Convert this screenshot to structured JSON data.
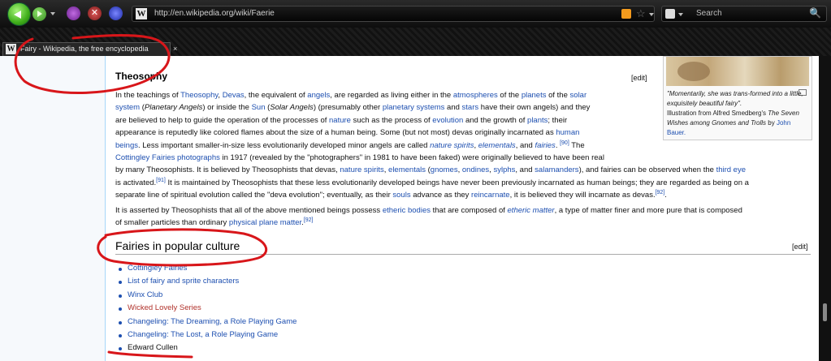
{
  "browser": {
    "url": "http://en.wikipedia.org/wiki/Faerie",
    "search_placeholder": "Search",
    "tab_title": "Fairy - Wikipedia, the free encyclopedia",
    "favicon_letter": "W",
    "stop_glyph": "✕",
    "star_glyph": "☆",
    "search_glyph": "🔍",
    "close_glyph": "×",
    "icons": [
      "back-arrow-icon",
      "forward-arrow-icon",
      "reload-icon",
      "stop-icon",
      "home-icon",
      "rss-icon",
      "bookmark-star-icon",
      "search-engine-icon",
      "magnifier-icon"
    ]
  },
  "article": {
    "section_theosophy": {
      "heading": "Theosophy",
      "edit": "[edit]"
    },
    "thumb": {
      "caption_quote": "\"Momentarily, she was trans-formed into a little, exquisitely beautiful fairy\".",
      "caption_line": "Illustration from Alfred Smedberg's",
      "caption_title": "The Seven Wishes among Gnomes and Trolls",
      "caption_by": "by",
      "caption_artist": "John Bauer."
    },
    "section_popular": {
      "heading": "Fairies in popular culture",
      "edit": "[edit]",
      "items": [
        {
          "label": "Cottingley Fairies",
          "style": "link"
        },
        {
          "label": "List of fairy and sprite characters",
          "style": "link"
        },
        {
          "label": "Winx Club",
          "style": "link"
        },
        {
          "label": "Wicked Lovely Series",
          "style": "new"
        },
        {
          "label": "Changeling: The Dreaming, a Role Playing Game",
          "style": "link"
        },
        {
          "label": "Changeling: The Lost, a Role Playing Game",
          "style": "link"
        },
        {
          "label": "Edward Cullen",
          "style": "plain"
        }
      ]
    },
    "para1_lines": [
      [
        {
          "t": "In the teachings of "
        },
        {
          "t": "Theosophy",
          "l": 1
        },
        {
          "t": ", "
        },
        {
          "t": "Devas",
          "l": 1
        },
        {
          "t": ", the equivalent of "
        },
        {
          "t": "angels",
          "l": 1
        },
        {
          "t": ", are regarded as living either in the "
        },
        {
          "t": "atmospheres",
          "l": 1
        },
        {
          "t": " of the "
        },
        {
          "t": "planets",
          "l": 1
        },
        {
          "t": " of the "
        },
        {
          "t": "solar",
          "l": 1
        }
      ],
      [
        {
          "t": "system",
          "l": 1
        },
        {
          "t": " ("
        },
        {
          "t": "Planetary Angels",
          "i": 1
        },
        {
          "t": ") or inside the "
        },
        {
          "t": "Sun",
          "l": 1
        },
        {
          "t": " ("
        },
        {
          "t": "Solar Angels",
          "i": 1
        },
        {
          "t": ") (presumably other "
        },
        {
          "t": "planetary systems",
          "l": 1
        },
        {
          "t": " and "
        },
        {
          "t": "stars",
          "l": 1
        },
        {
          "t": " have their own angels) and they"
        }
      ],
      [
        {
          "t": "are believed to help to guide the operation of the processes of "
        },
        {
          "t": "nature",
          "l": 1
        },
        {
          "t": " such as the process of "
        },
        {
          "t": "evolution",
          "l": 1
        },
        {
          "t": " and the growth of "
        },
        {
          "t": "plants",
          "l": 1
        },
        {
          "t": "; their"
        }
      ],
      [
        {
          "t": "appearance is reputedly like colored flames about the size of a human being. Some (but not most) devas originally incarnated as "
        },
        {
          "t": "human",
          "l": 1
        }
      ],
      [
        {
          "t": "beings",
          "l": 1
        },
        {
          "t": ". Less important smaller-in-size less evolutionarily developed minor angels are called "
        },
        {
          "t": "nature spirits",
          "l": 1,
          "i": 1
        },
        {
          "t": ", "
        },
        {
          "t": "elementals",
          "l": 1,
          "i": 1
        },
        {
          "t": ", and "
        },
        {
          "t": "fairies",
          "l": 1,
          "i": 1
        },
        {
          "t": ". "
        },
        {
          "t": "[90]",
          "c": 1
        },
        {
          "t": " The"
        }
      ],
      [
        {
          "t": "Cottingley Fairies photographs",
          "l": 1
        },
        {
          "t": " in 1917 (revealed by the \"photographers\" in 1981 to have been faked) were originally believed to have been real"
        }
      ],
      [
        {
          "t": "by many Theosophists. It is believed by Theosophists that devas, "
        },
        {
          "t": "nature spirits",
          "l": 1
        },
        {
          "t": ", "
        },
        {
          "t": "elementals",
          "l": 1
        },
        {
          "t": " ("
        },
        {
          "t": "gnomes",
          "l": 1
        },
        {
          "t": ", "
        },
        {
          "t": "ondines",
          "l": 1
        },
        {
          "t": ", "
        },
        {
          "t": "sylphs",
          "l": 1
        },
        {
          "t": ", and "
        },
        {
          "t": "salamanders",
          "l": 1
        },
        {
          "t": "), and fairies can be observed when the "
        },
        {
          "t": "third eye",
          "l": 1
        }
      ],
      [
        {
          "t": "is activated."
        },
        {
          "t": "[91]",
          "c": 1
        },
        {
          "t": " It is maintained by Theosophists that these less evolutionarily developed beings have never been previously incarnated as human beings; they are regarded as being on a"
        }
      ],
      [
        {
          "t": "separate line of spiritual evolution called the \"deva evolution\"; eventually, as their "
        },
        {
          "t": "souls",
          "l": 1
        },
        {
          "t": " advance as they "
        },
        {
          "t": "reincarnate",
          "l": 1
        },
        {
          "t": ", it is believed they will incarnate as devas."
        },
        {
          "t": "[92]",
          "c": 1
        },
        {
          "t": "."
        }
      ]
    ],
    "para2_lines": [
      [
        {
          "t": "It is asserted by Theosophists that all of the above mentioned beings possess "
        },
        {
          "t": "etheric bodies",
          "l": 1
        },
        {
          "t": " that are composed of "
        },
        {
          "t": "etheric matter",
          "l": 1,
          "i": 1
        },
        {
          "t": ", a type of matter finer and more pure that is composed"
        }
      ],
      [
        {
          "t": "of smaller particles than ordinary "
        },
        {
          "t": "physical plane matter",
          "l": 1
        },
        {
          "t": "."
        },
        {
          "t": "[92]",
          "c": 1
        }
      ]
    ]
  },
  "colors": {
    "link": "#1d4fb0",
    "new_link": "#b0312a",
    "marker_red": "#d8161a"
  }
}
